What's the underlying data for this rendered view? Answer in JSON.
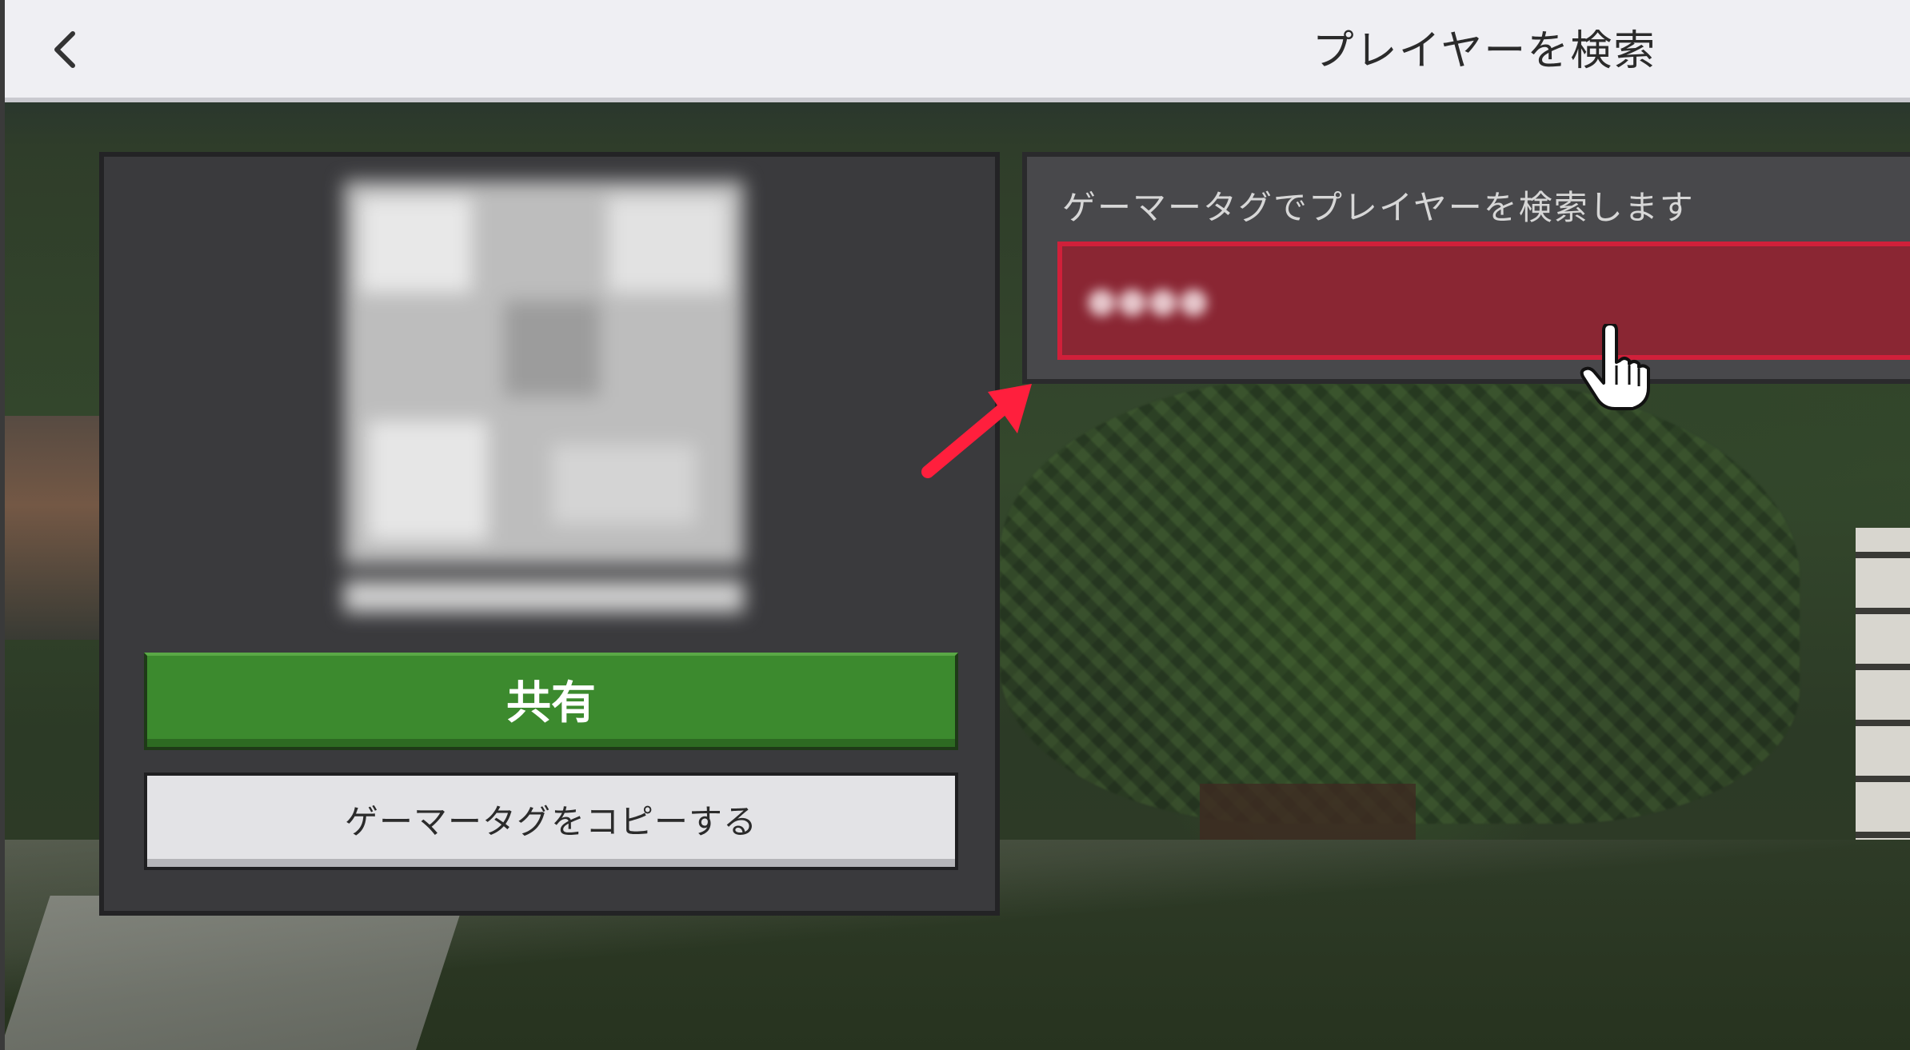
{
  "header": {
    "title": "プレイヤーを検索",
    "back_icon": "chevron-left-icon"
  },
  "profile_panel": {
    "qr_code_blurred": true,
    "share_label": "共有",
    "copy_gamertag_label": "ゲーマータグをコピーする",
    "share_color": "#3c8a2e"
  },
  "search_panel": {
    "label": "ゲーマータグでプレイヤーを検索します",
    "input_value": "●●●●",
    "input_highlight_color": "#d0203a"
  },
  "annotations": {
    "arrow_icon": "red-arrow-icon",
    "cursor_icon": "hand-pointer-icon"
  }
}
